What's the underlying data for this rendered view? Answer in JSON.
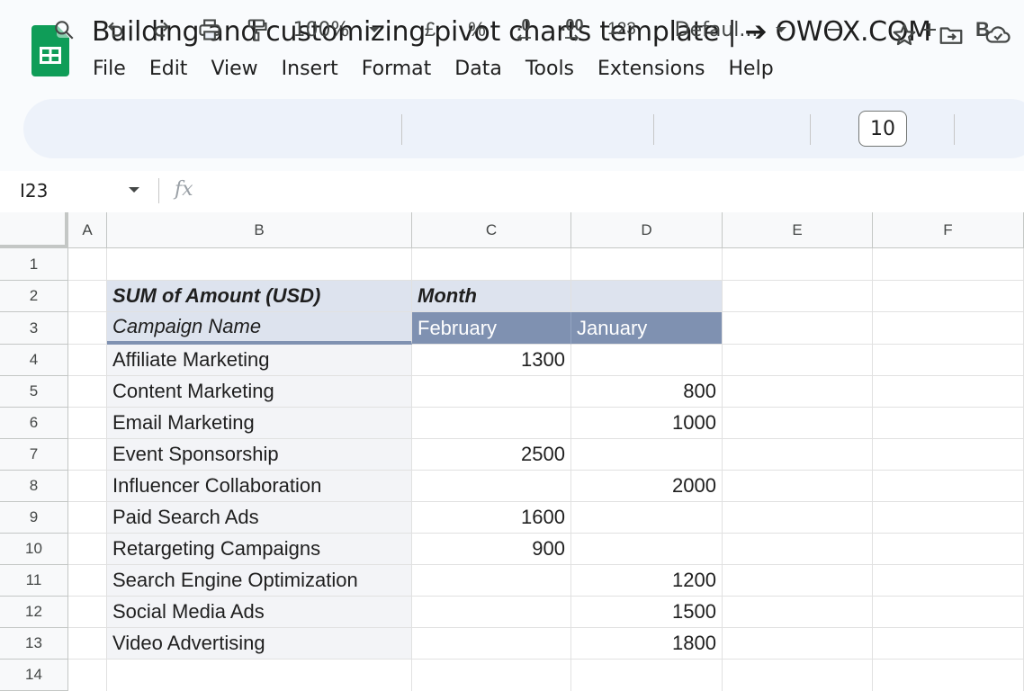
{
  "doc": {
    "title": "Building and customizing pivot charts template | ➔ OWOX.COM",
    "menu": [
      "File",
      "Edit",
      "View",
      "Insert",
      "Format",
      "Data",
      "Tools",
      "Extensions",
      "Help"
    ]
  },
  "toolbar": {
    "zoom": "100%",
    "currency": "£",
    "percent": "%",
    "dec_decrease": ".0",
    "dec_increase": ".00",
    "number_format": "123",
    "font": "Defaul...",
    "font_size": "10",
    "bold": "B"
  },
  "formula_bar": {
    "cell_ref": "I23",
    "fx": "fx"
  },
  "columns": [
    "A",
    "B",
    "C",
    "D",
    "E",
    "F"
  ],
  "rows": [
    "1",
    "2",
    "3",
    "4",
    "5",
    "6",
    "7",
    "8",
    "9",
    "10",
    "11",
    "12",
    "13",
    "14"
  ],
  "pivot": {
    "value_label": "SUM of Amount (USD)",
    "col_group_label": "Month",
    "row_label": "Campaign Name",
    "months": [
      "February",
      "January"
    ],
    "data": [
      {
        "name": "Affiliate Marketing",
        "feb": "1300",
        "jan": ""
      },
      {
        "name": "Content Marketing",
        "feb": "",
        "jan": "800"
      },
      {
        "name": "Email Marketing",
        "feb": "",
        "jan": "1000"
      },
      {
        "name": "Event Sponsorship",
        "feb": "2500",
        "jan": ""
      },
      {
        "name": "Influencer Collaboration",
        "feb": "",
        "jan": "2000"
      },
      {
        "name": "Paid Search Ads",
        "feb": "1600",
        "jan": ""
      },
      {
        "name": "Retargeting Campaigns",
        "feb": "900",
        "jan": ""
      },
      {
        "name": "Search Engine Optimization",
        "feb": "",
        "jan": "1200"
      },
      {
        "name": "Social Media Ads",
        "feb": "",
        "jan": "1500"
      },
      {
        "name": "Video Advertising",
        "feb": "",
        "jan": "1800"
      }
    ]
  },
  "colors": {
    "pivot_header_bg": "#dde3ee",
    "month_bg": "#7f91b1",
    "name_bg": "#f3f4f7",
    "logo_green": "#0f9d58"
  }
}
